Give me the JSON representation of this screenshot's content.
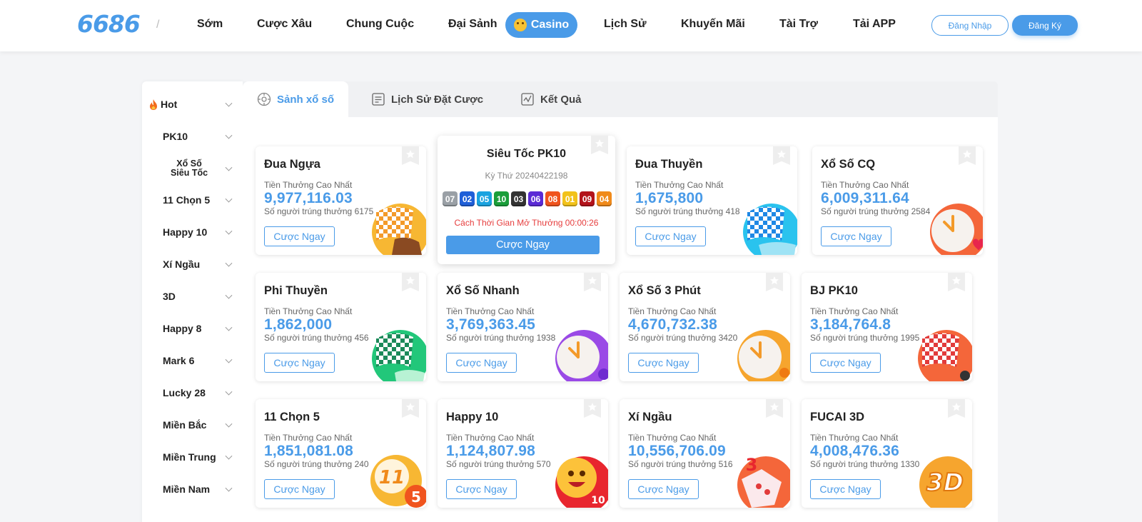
{
  "header": {
    "logo": "6686",
    "nav": [
      {
        "label": "Sớm"
      },
      {
        "label": "Cược Xâu"
      },
      {
        "label": "Chung Cuộc"
      },
      {
        "label": "Đại Sảnh"
      },
      {
        "label": "Lịch Sử"
      },
      {
        "label": "Khuyến Mãi"
      },
      {
        "label": "Tài Trợ"
      },
      {
        "label": "Tải APP"
      }
    ],
    "casino_label": "Casino",
    "login_label": "Đăng Nhập",
    "register_label": "Đăng Ký"
  },
  "sidebar": {
    "items": [
      {
        "label": "Hot",
        "icon": "fire-icon"
      },
      {
        "label": "PK10"
      },
      {
        "label": "Xổ Số Siêu Tốc"
      },
      {
        "label": "11 Chọn 5"
      },
      {
        "label": "Happy 10"
      },
      {
        "label": "Xí Ngầu"
      },
      {
        "label": "3D"
      },
      {
        "label": "Happy 8"
      },
      {
        "label": "Mark 6"
      },
      {
        "label": "Lucky 28"
      },
      {
        "label": "Miền Bắc"
      },
      {
        "label": "Miền Trung"
      },
      {
        "label": "Miền Nam"
      }
    ]
  },
  "tabs": [
    {
      "label": "Sảnh xổ số",
      "icon": "lottery-hall-icon",
      "active": true
    },
    {
      "label": "Lịch Sử Đặt Cược",
      "icon": "bet-history-icon",
      "active": false
    },
    {
      "label": "Kết Quả",
      "icon": "results-chart-icon",
      "active": false
    }
  ],
  "card_common": {
    "prize_label": "Tiền Thưởng Cao Nhất",
    "winners_prefix": "Số người trúng thưởng",
    "button_label": "Cược Ngay"
  },
  "featured": {
    "title": "Siêu Tốc PK10",
    "period": "Kỳ Thứ 20240422198",
    "balls": [
      {
        "n": "07",
        "color": "#9aa0a6"
      },
      {
        "n": "02",
        "color": "#1f5fd8"
      },
      {
        "n": "05",
        "color": "#1aa3e0"
      },
      {
        "n": "10",
        "color": "#1a9e3a"
      },
      {
        "n": "03",
        "color": "#333333"
      },
      {
        "n": "06",
        "color": "#5b2ad6"
      },
      {
        "n": "08",
        "color": "#f0541e"
      },
      {
        "n": "01",
        "color": "#f2c21b"
      },
      {
        "n": "09",
        "color": "#b3131b"
      },
      {
        "n": "04",
        "color": "#f08a1a"
      }
    ],
    "countdown": "Cách Thời Gian Mở Thưởng 00:00:26",
    "button_label": "Cược Ngay"
  },
  "cards": [
    {
      "title": "Đua Ngựa",
      "prize": "9,977,116.03",
      "winners": "6175",
      "art": "horse-flag-icon"
    },
    {
      "title": "Đua Thuyền",
      "prize": "1,675,800",
      "winners": "418",
      "art": "boat-flag-icon"
    },
    {
      "title": "Xổ Số CQ",
      "prize": "6,009,311.64",
      "winners": "2584",
      "art": "clock-heart-icon"
    },
    {
      "title": "Phi Thuyền",
      "prize": "1,862,000",
      "winners": "456",
      "art": "spaceship-flag-icon"
    },
    {
      "title": "Xổ Số Nhanh",
      "prize": "3,769,363.45",
      "winners": "1938",
      "art": "clock-purple-icon"
    },
    {
      "title": "Xổ Số 3 Phút",
      "prize": "4,670,732.38",
      "winners": "3420",
      "art": "clock-orange-icon"
    },
    {
      "title": "BJ PK10",
      "prize": "3,184,764.8",
      "winners": "1995",
      "art": "racecar-flag-icon"
    },
    {
      "title": "11 Chọn 5",
      "prize": "1,851,081.08",
      "winners": "240",
      "art": "ball-11-5-icon"
    },
    {
      "title": "Happy 10",
      "prize": "1,124,807.98",
      "winners": "570",
      "art": "happy-face-icon"
    },
    {
      "title": "Xí Ngầu",
      "prize": "10,556,706.09",
      "winners": "516",
      "art": "dice-icon"
    },
    {
      "title": "FUCAI 3D",
      "prize": "4,008,476.36",
      "winners": "1330",
      "art": "text-3d-icon"
    }
  ],
  "colors": {
    "accent": "#4a9be8",
    "countdown": "#e63d3d"
  }
}
